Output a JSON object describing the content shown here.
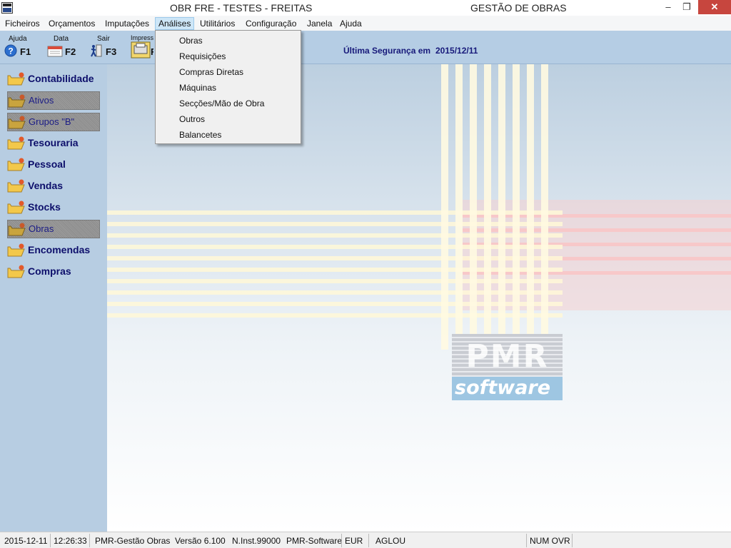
{
  "window": {
    "title_left": "OBR FRE - TESTES - FREITAS",
    "title_right": "GESTÃO DE OBRAS",
    "minimize": "–",
    "restore": "❐",
    "close": "✕"
  },
  "menubar": {
    "items": [
      {
        "label": "Ficheiros"
      },
      {
        "label": "Orçamentos"
      },
      {
        "label": "Imputações"
      },
      {
        "label": "Análises"
      },
      {
        "label": "Utilitários"
      },
      {
        "label": "Configuração"
      },
      {
        "label": "Janela"
      },
      {
        "label": "Ajuda"
      }
    ]
  },
  "toolbar": {
    "buttons": [
      {
        "label": "Ajuda",
        "key": "F1",
        "icon": "help-icon"
      },
      {
        "label": "Data",
        "key": "F2",
        "icon": "calendar-icon"
      },
      {
        "label": "Sair",
        "key": "F3",
        "icon": "exit-icon"
      },
      {
        "label": "Impress",
        "key": "F",
        "icon": "printer-icon"
      }
    ],
    "backup_label": "Última Segurança em",
    "backup_date": "2015/12/11"
  },
  "sidebar": {
    "items": [
      {
        "label": "Contabilidade",
        "sub": false
      },
      {
        "label": "Ativos",
        "sub": true
      },
      {
        "label": "Grupos \"B\"",
        "sub": true
      },
      {
        "label": "Tesouraria",
        "sub": false
      },
      {
        "label": "Pessoal",
        "sub": false
      },
      {
        "label": "Vendas",
        "sub": false
      },
      {
        "label": "Stocks",
        "sub": false
      },
      {
        "label": "Obras",
        "sub": true
      },
      {
        "label": "Encomendas",
        "sub": false
      },
      {
        "label": "Compras",
        "sub": false
      }
    ]
  },
  "dropdown": {
    "items": [
      {
        "label": "Obras"
      },
      {
        "label": "Requisições"
      },
      {
        "label": "Compras Diretas"
      },
      {
        "label": "Máquinas"
      },
      {
        "label": "Secções/Mão de Obra"
      },
      {
        "label": "Outros"
      },
      {
        "label": "Balancetes"
      }
    ]
  },
  "logo": {
    "top": "PMR",
    "bottom": "software"
  },
  "statusbar": {
    "date": "2015-12-11",
    "time": "12:26:33",
    "product": "PMR-Gestão Obras",
    "version": "Versão  6.100",
    "install": "N.Inst.99000",
    "company": "PMR-Software",
    "currency": "EUR",
    "user": "AGLOU",
    "keys": "NUM OVR"
  }
}
